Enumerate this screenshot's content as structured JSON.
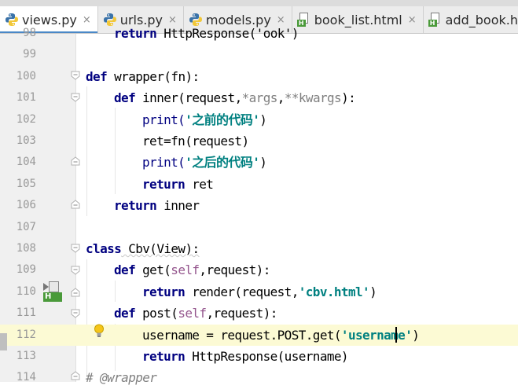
{
  "tabs": [
    {
      "label": "views.py",
      "icon": "python-file-icon",
      "active": true
    },
    {
      "label": "urls.py",
      "icon": "python-file-icon",
      "active": false
    },
    {
      "label": "models.py",
      "icon": "python-file-icon",
      "active": false
    },
    {
      "label": "book_list.html",
      "icon": "html-file-icon",
      "active": false
    },
    {
      "label": "add_book.ht",
      "icon": "html-file-icon",
      "active": false
    }
  ],
  "close_glyph": "×",
  "gutter_html_badge": "H",
  "lines": [
    {
      "n": "98"
    },
    {
      "n": "99"
    },
    {
      "n": "100"
    },
    {
      "n": "101"
    },
    {
      "n": "102"
    },
    {
      "n": "103"
    },
    {
      "n": "104"
    },
    {
      "n": "105"
    },
    {
      "n": "106"
    },
    {
      "n": "107"
    },
    {
      "n": "108"
    },
    {
      "n": "109"
    },
    {
      "n": "110"
    },
    {
      "n": "111"
    },
    {
      "n": "112"
    },
    {
      "n": "113"
    },
    {
      "n": "114"
    }
  ],
  "code": {
    "l98": {
      "kw": "return",
      "rest": " HttpResponse('ook')"
    },
    "l100": {
      "kw": "def",
      "rest": " wrapper(fn):"
    },
    "l101": {
      "kw": "def",
      "name": " inner(request,",
      "args": "*args",
      "comma": ",",
      "kwargs": "**kwargs",
      "end": "):"
    },
    "l102": {
      "fn": "print(",
      "str": "'之前的代码'",
      "end": ")"
    },
    "l103": {
      "text": "ret=fn(request)"
    },
    "l104": {
      "fn": "print(",
      "str": "'之后的代码'",
      "end": ")"
    },
    "l105": {
      "kw": "return",
      "rest": " ret"
    },
    "l106": {
      "kw": "return",
      "rest": " inner"
    },
    "l108": {
      "kw": "class",
      "rest": " Cbv(View):"
    },
    "l109": {
      "kw": "def",
      "name": " get(",
      "self": "self",
      "end": ",request):"
    },
    "l110": {
      "kw": "return",
      "rest": " render(request,",
      "str": "'cbv.html'",
      "end": ")"
    },
    "l111": {
      "kw": "def",
      "name": " post(",
      "self": "self",
      "end": ",request):"
    },
    "l112": {
      "rest": "username = request.POST.get(",
      "str": "'username'",
      "end": ")"
    },
    "l113": {
      "kw": "return",
      "rest": " HttpResponse(username)"
    },
    "l114": {
      "comment": "# @wrapper"
    }
  },
  "colors": {
    "keyword": "#000080",
    "string": "#008080",
    "self": "#94558d",
    "line_number": "#999999",
    "current_line": "#fcfad4",
    "tab_active_underline": "#4a88c7"
  }
}
